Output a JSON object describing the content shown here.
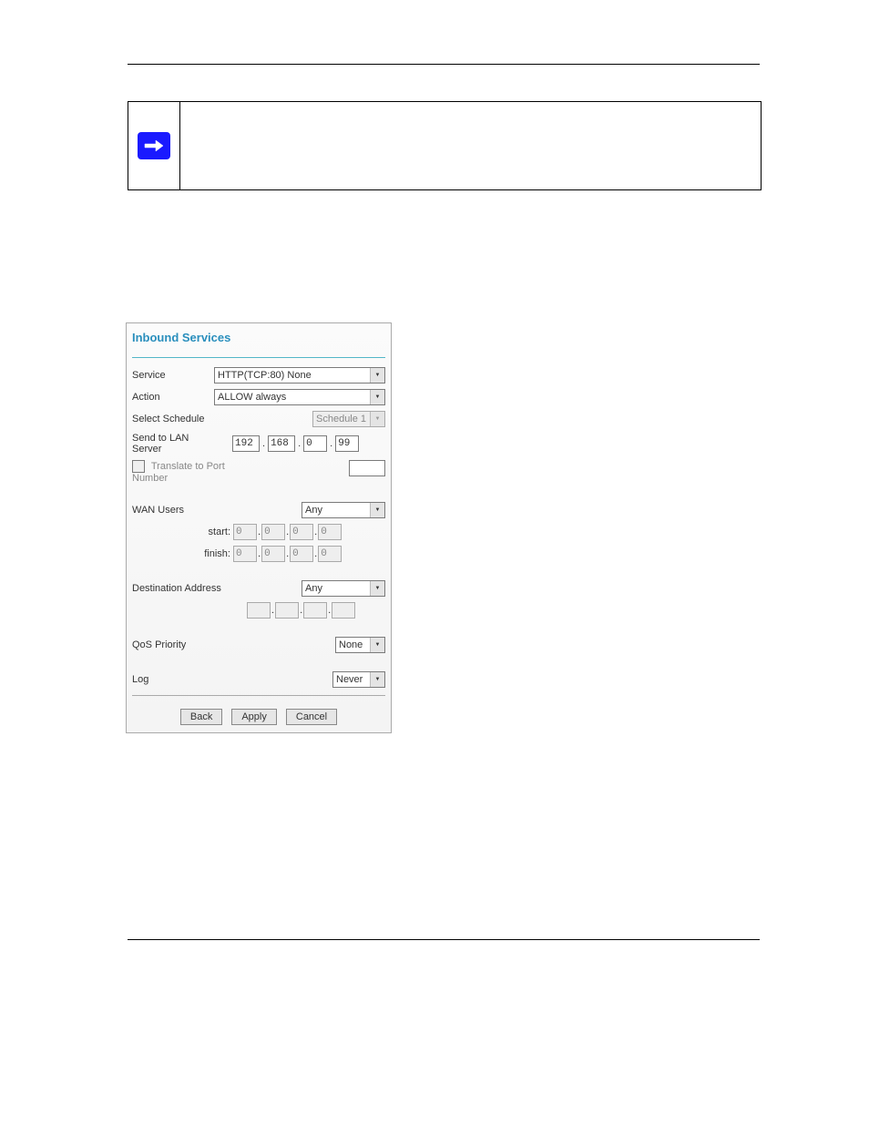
{
  "form": {
    "title": "Inbound Services",
    "labels": {
      "service": "Service",
      "action": "Action",
      "select_schedule": "Select Schedule",
      "send_to_lan": "Send to LAN Server",
      "translate_to": "Translate to Port Number",
      "wan_users": "WAN Users",
      "start": "start:",
      "finish": "finish:",
      "dest_addr": "Destination Address",
      "qos": "QoS Priority",
      "log": "Log"
    },
    "values": {
      "service": "HTTP(TCP:80) None",
      "action": "ALLOW always",
      "schedule": "Schedule 1",
      "lan_ip": [
        "192",
        "168",
        "0",
        "99"
      ],
      "translate_port": "",
      "wan_users": "Any",
      "start_ip": [
        "0",
        "0",
        "0",
        "0"
      ],
      "finish_ip": [
        "0",
        "0",
        "0",
        "0"
      ],
      "dest_addr": "Any",
      "dest_ip": [
        "",
        "",
        "",
        ""
      ],
      "qos": "None",
      "log": "Never"
    },
    "buttons": {
      "back": "Back",
      "apply": "Apply",
      "cancel": "Cancel"
    }
  }
}
